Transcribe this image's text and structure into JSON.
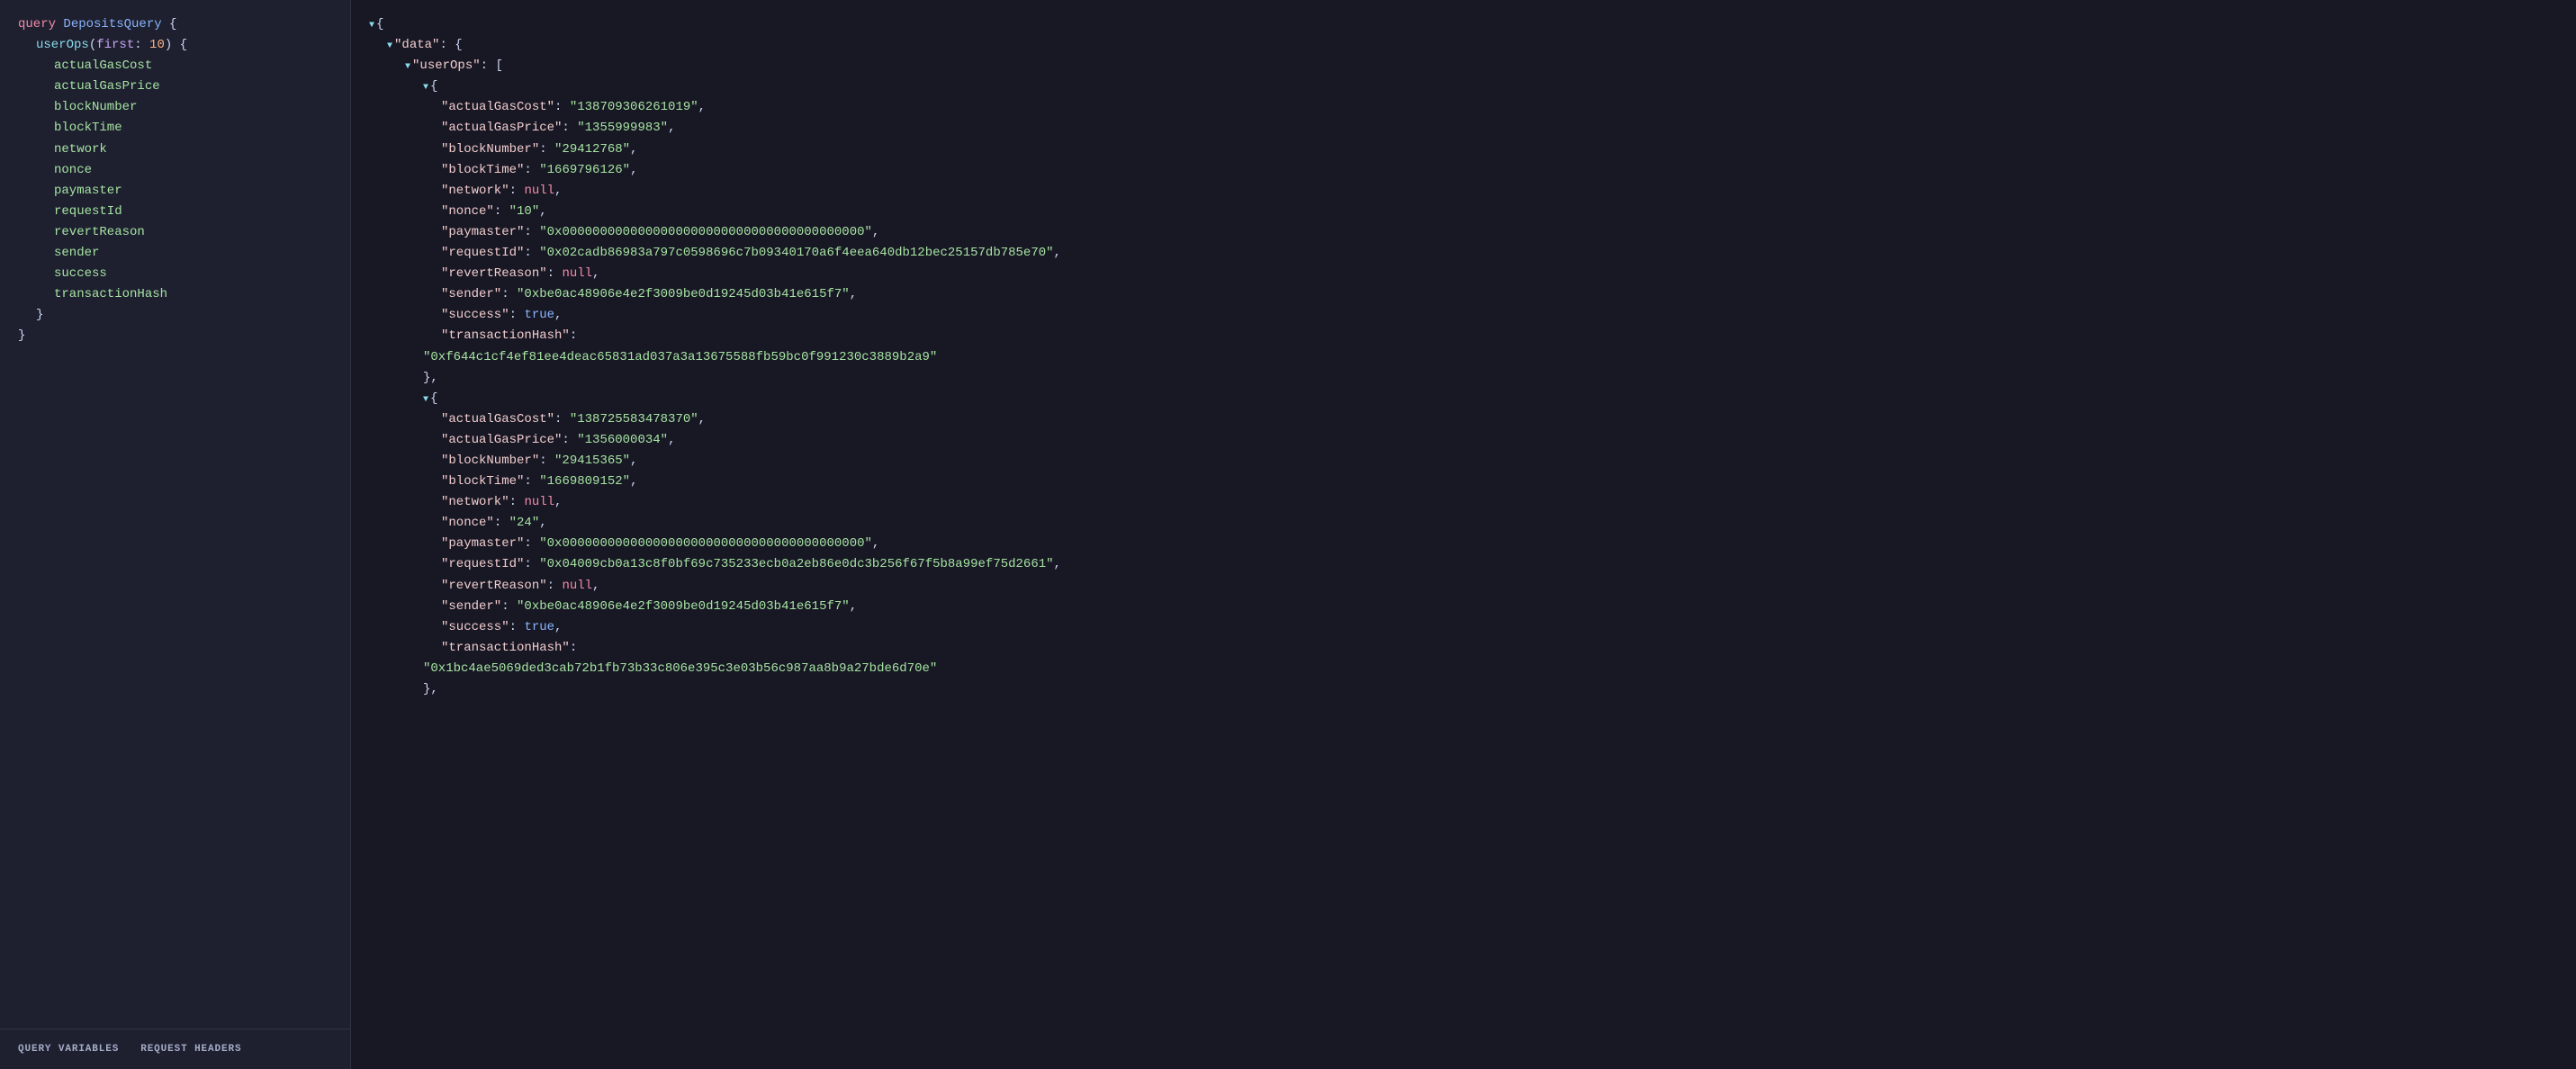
{
  "left_panel": {
    "query_line": "query DepositsQuery {",
    "query_kw": "query",
    "query_name": "DepositsQuery",
    "userop_line": "  userOps(first: 10) {",
    "userop_func": "userOps",
    "userop_param": "first",
    "userop_value": "10",
    "fields": [
      "actualGasCost",
      "actualGasPrice",
      "blockNumber",
      "blockTime",
      "network",
      "nonce",
      "paymaster",
      "requestId",
      "revertReason",
      "sender",
      "success",
      "transactionHash"
    ],
    "close_inner": "  }",
    "close_outer": "}",
    "tabs": [
      {
        "id": "query-variables",
        "label": "QUERY VARIABLES",
        "active": false
      },
      {
        "id": "request-headers",
        "label": "REQUEST HEADERS",
        "active": false
      }
    ]
  },
  "right_panel": {
    "entries": [
      {
        "actualGasCost": "138709306261019",
        "actualGasPrice": "1355999983",
        "blockNumber": "29412768",
        "blockTime": "1669796126",
        "network": null,
        "nonce": "10",
        "paymaster": "0x0000000000000000000000000000000000000000",
        "requestId": "0x02cadb86983a797c0598696c7b09340170a6f4eea640db12bec25157db785e70",
        "revertReason": null,
        "sender": "0xbe0ac48906e4e2f3009be0d19245d03b41e615f7",
        "success": true,
        "transactionHash": "0xf644c1cf4ef81ee4deac65831ad037a3a13675588fb59bc0f991230c3889b2a9"
      },
      {
        "actualGasCost": "13872558347837​0",
        "actualGasPrice": "1356000034",
        "blockNumber": "29415365",
        "blockTime": "1669809152",
        "network": null,
        "nonce": "24",
        "paymaster": "0x0000000000000000000000000000000000000000",
        "requestId": "0x04009cb0a13c8f0bf69c735233ecb0a2eb86e0dc3b256f67f5b8a99ef75d2661",
        "revertReason": null,
        "sender": "0xbe0ac48906e4e2f3009be0d19245d03b41e615f7",
        "success": true,
        "transactionHash": "0x1bc4ae5069ded3cab72b1fb73b33c806e395c3e03b56c987aa8b9a27bde6d70e"
      }
    ]
  }
}
